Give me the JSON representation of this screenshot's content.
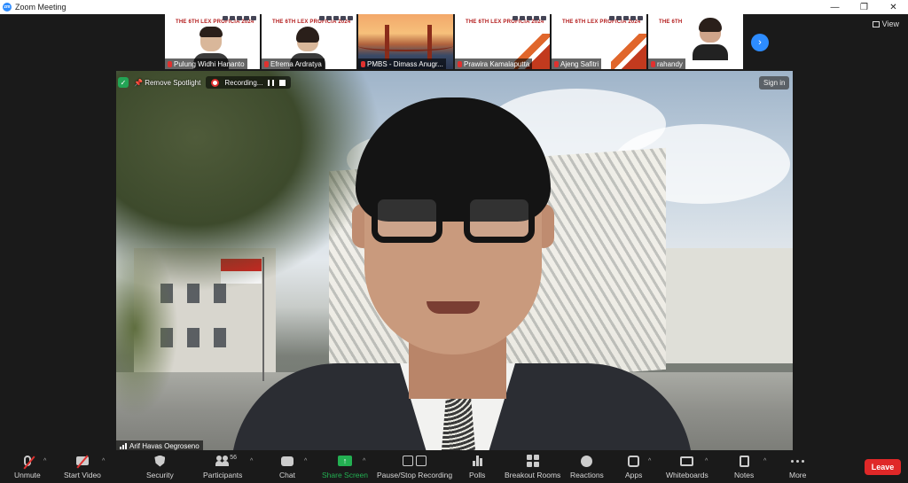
{
  "window": {
    "title": "Zoom Meeting",
    "controls": {
      "minimize": "—",
      "restore": "❐",
      "close": "✕"
    }
  },
  "thumbnails": [
    {
      "name": "Pulung Widhi Hananto",
      "slide_title": "THE 6TH LEX PROFICIA 2024",
      "type": "slide-face"
    },
    {
      "name": "Efrema Ardratya",
      "slide_title": "THE 6TH LEX PROFICIA 2024",
      "type": "slide-face"
    },
    {
      "name": "PMBS - Dimass Anugr...",
      "slide_title": "",
      "type": "bridge"
    },
    {
      "name": "Prawira Kamalaputta",
      "slide_title": "THE 6TH LEX PROFICIA 2024",
      "type": "slide"
    },
    {
      "name": "Ajeng Safitri",
      "slide_title": "THE 6TH LEX PROFICIA 2024",
      "type": "slide"
    },
    {
      "name": "rahandy",
      "slide_title": "THE 6TH",
      "type": "headset"
    }
  ],
  "view_button": {
    "label": "View",
    "icon": "grid-icon"
  },
  "main": {
    "speaker_name": "Arif Havas Oegroseno",
    "remove_spotlight": "Remove Spotlight",
    "recording_label": "Recording...",
    "sign_in": "Sign in"
  },
  "toolbar": {
    "unmute": "Unmute",
    "start_video": "Start Video",
    "security": "Security",
    "participants": "Participants",
    "participants_count": "56",
    "chat": "Chat",
    "share_screen": "Share Screen",
    "pause_stop_recording": "Pause/Stop Recording",
    "polls": "Polls",
    "breakout_rooms": "Breakout Rooms",
    "reactions": "Reactions",
    "apps": "Apps",
    "whiteboards": "Whiteboards",
    "notes": "Notes",
    "more": "More",
    "leave": "Leave"
  },
  "colors": {
    "zoom_blue": "#2d8cff",
    "leave_red": "#e02828",
    "share_green": "#23b052",
    "toolbar_bg": "#1a1a1a"
  }
}
